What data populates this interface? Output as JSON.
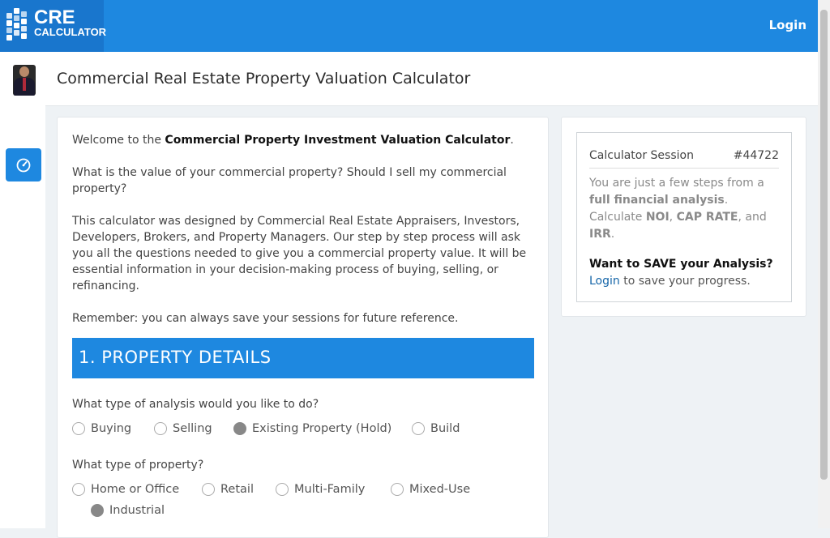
{
  "header": {
    "logo_line1": "CRE",
    "logo_line2": "CALCULATOR",
    "login_label": "Login"
  },
  "page_title": "Commercial Real Estate Property Valuation Calculator",
  "intro": {
    "welcome_prefix": "Welcome to the ",
    "welcome_bold": "Commercial Property Investment Valuation Calculator",
    "welcome_suffix": ".",
    "question_line1": "What is the value of your commercial property? Should I sell my commercial",
    "question_line2": "property?",
    "about_line1": "This calculator was designed by Commercial Real Estate Appraisers, Investors,",
    "about_line2": "Developers, Brokers, and Property Managers. Our step by step process will ask",
    "about_line3": "you all the questions needed to give you a commercial property value. It will be",
    "about_line4": "essential information in your decision-making process of buying, selling, or",
    "about_line5": "refinancing.",
    "remember": "Remember: you can always save your sessions for future reference."
  },
  "section": {
    "title": "1. PROPERTY DETAILS"
  },
  "analysis_question": "What type of analysis would you like to do?",
  "analysis_options": [
    {
      "label": "Buying",
      "checked": false
    },
    {
      "label": "Selling",
      "checked": false
    },
    {
      "label": "Existing Property (Hold)",
      "checked": true
    },
    {
      "label": "Build",
      "checked": false
    }
  ],
  "property_question": "What type of property?",
  "property_options": [
    {
      "label": "Home or Office",
      "checked": false
    },
    {
      "label": "Retail",
      "checked": false
    },
    {
      "label": "Multi-Family",
      "checked": false
    },
    {
      "label": "Mixed-Use",
      "checked": false
    },
    {
      "label": "Industrial",
      "checked": true
    }
  ],
  "session": {
    "label": "Calculator Session",
    "id": "#44722",
    "desc_1": "You are just a few steps from a",
    "desc_2_bold": "full financial analysis",
    "desc_2_rest": ".",
    "desc_3_a": "Calculate ",
    "desc_3_noi": "NOI",
    "desc_3_sep": ", ",
    "desc_3_cap": "CAP RATE",
    "desc_3_and": ", and",
    "desc_4_irr": "IRR",
    "desc_4_rest": ".",
    "save_heading": "Want to SAVE your Analysis?",
    "save_link": "Login",
    "save_rest": " to save your progress."
  },
  "icons": {
    "logo": "building-blocks-icon",
    "dashboard": "speedometer-icon",
    "avatar": "user-photo"
  },
  "colors": {
    "primary": "#1e88e0",
    "logo_bg": "#1976cd",
    "page_bg": "#eef2f5",
    "link": "#1565a8",
    "radio_checked": "#888888"
  }
}
